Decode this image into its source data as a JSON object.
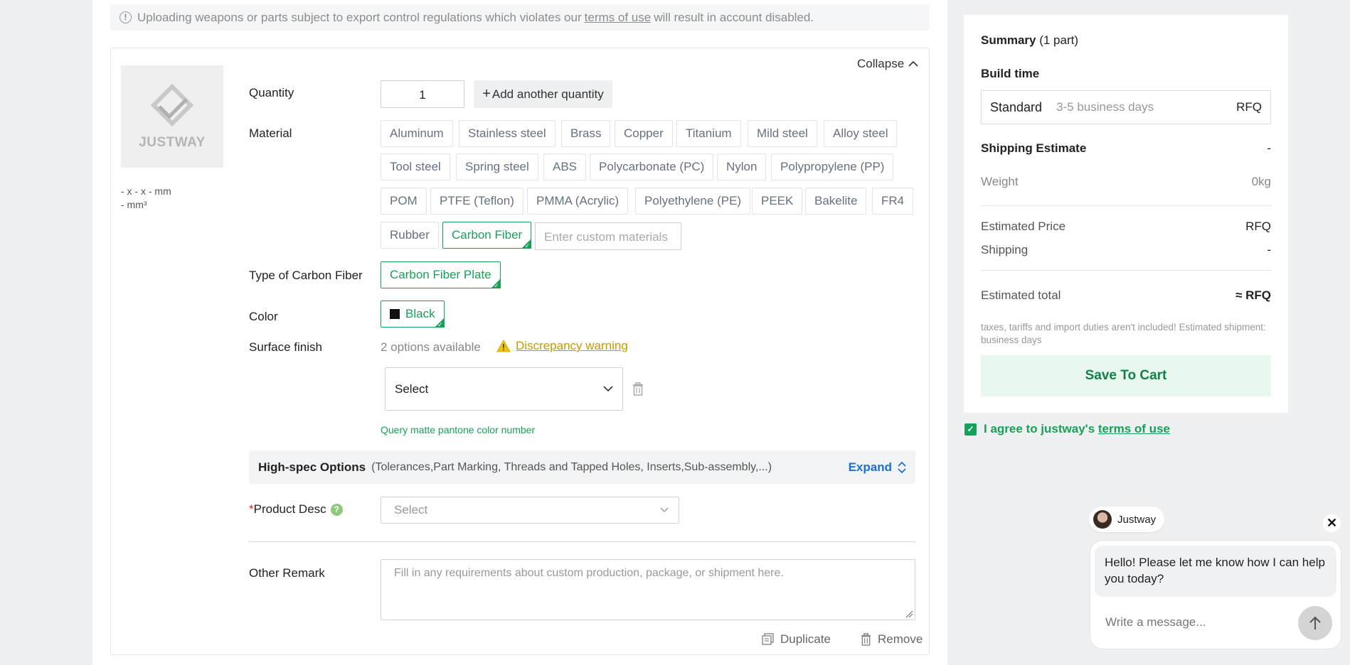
{
  "notice": {
    "text_before": "Uploading weapons or parts subject to export control regulations which violates our",
    "link": "terms of use",
    "text_after": "will result in account disabled."
  },
  "part": {
    "collapse_label": "Collapse",
    "thumbnail_logo_text": "JUSTWAY",
    "dimensions": "- x - x - mm",
    "volume": "- mm³"
  },
  "quantity": {
    "label": "Quantity",
    "value": "1",
    "add_label": "Add another quantity"
  },
  "material": {
    "label": "Material",
    "options": [
      "Aluminum",
      "Stainless steel",
      "Brass",
      "Copper",
      "Titanium",
      "Mild steel",
      "Alloy steel",
      "Tool steel",
      "Spring steel",
      "ABS",
      "Polycarbonate (PC)",
      "Nylon",
      "Polypropylene (PP)",
      "POM",
      "PTFE (Teflon)",
      "PMMA (Acrylic)",
      "Polyethylene (PE)",
      "PEEK",
      "Bakelite",
      "FR4",
      "Rubber",
      "Carbon Fiber"
    ],
    "selected": "Carbon Fiber",
    "custom_placeholder": "Enter custom materials"
  },
  "type_of_material": {
    "label": "Type of Carbon Fiber",
    "selected": "Carbon Fiber Plate"
  },
  "color": {
    "label": "Color",
    "selected": "Black",
    "swatch": "#111111"
  },
  "surface_finish": {
    "label": "Surface finish",
    "available": "2 options available",
    "warning": "Discrepancy warning",
    "select_value": "Select",
    "pantone_link": "Query matte pantone color number"
  },
  "high_spec": {
    "title": "High-spec Options",
    "items": "(Tolerances,Part Marking, Threads and Tapped Holes, Inserts,Sub-assembly,...)",
    "expand_label": "Expand"
  },
  "product_desc": {
    "required_mark": "*",
    "label": "Product Desc",
    "help": "?",
    "placeholder": "Select"
  },
  "other_remark": {
    "label": "Other Remark",
    "placeholder": "Fill in any requirements about custom production, package, or shipment here."
  },
  "actions": {
    "duplicate": "Duplicate",
    "remove": "Remove"
  },
  "summary": {
    "title": "Summary",
    "count": "(1 part)",
    "build_time_label": "Build time",
    "build_option": "Standard",
    "build_days": "3-5 business days",
    "build_price": "RFQ",
    "shipping_estimate_label": "Shipping Estimate",
    "shipping_estimate_value": "-",
    "weight_label": "Weight",
    "weight_value": "0kg",
    "estimated_price_label": "Estimated Price",
    "estimated_price_value": "RFQ",
    "shipping_label": "Shipping",
    "shipping_value": "-",
    "estimated_total_label": "Estimated total",
    "estimated_total_value": "≈ RFQ",
    "note": "taxes, tariffs and import duties aren't included! Estimated shipment: business days",
    "save_button": "Save To Cart"
  },
  "agree": {
    "text": "I agree to justway's",
    "link": "terms of use",
    "checked": true
  },
  "chat": {
    "agent_name": "Justway",
    "message": "Hello! Please let me know how I can help you today?",
    "input_placeholder": "Write a message..."
  },
  "colors": {
    "accent_green": "#18a058",
    "link_blue": "#1a6fd1",
    "warning": "#c59a00"
  }
}
